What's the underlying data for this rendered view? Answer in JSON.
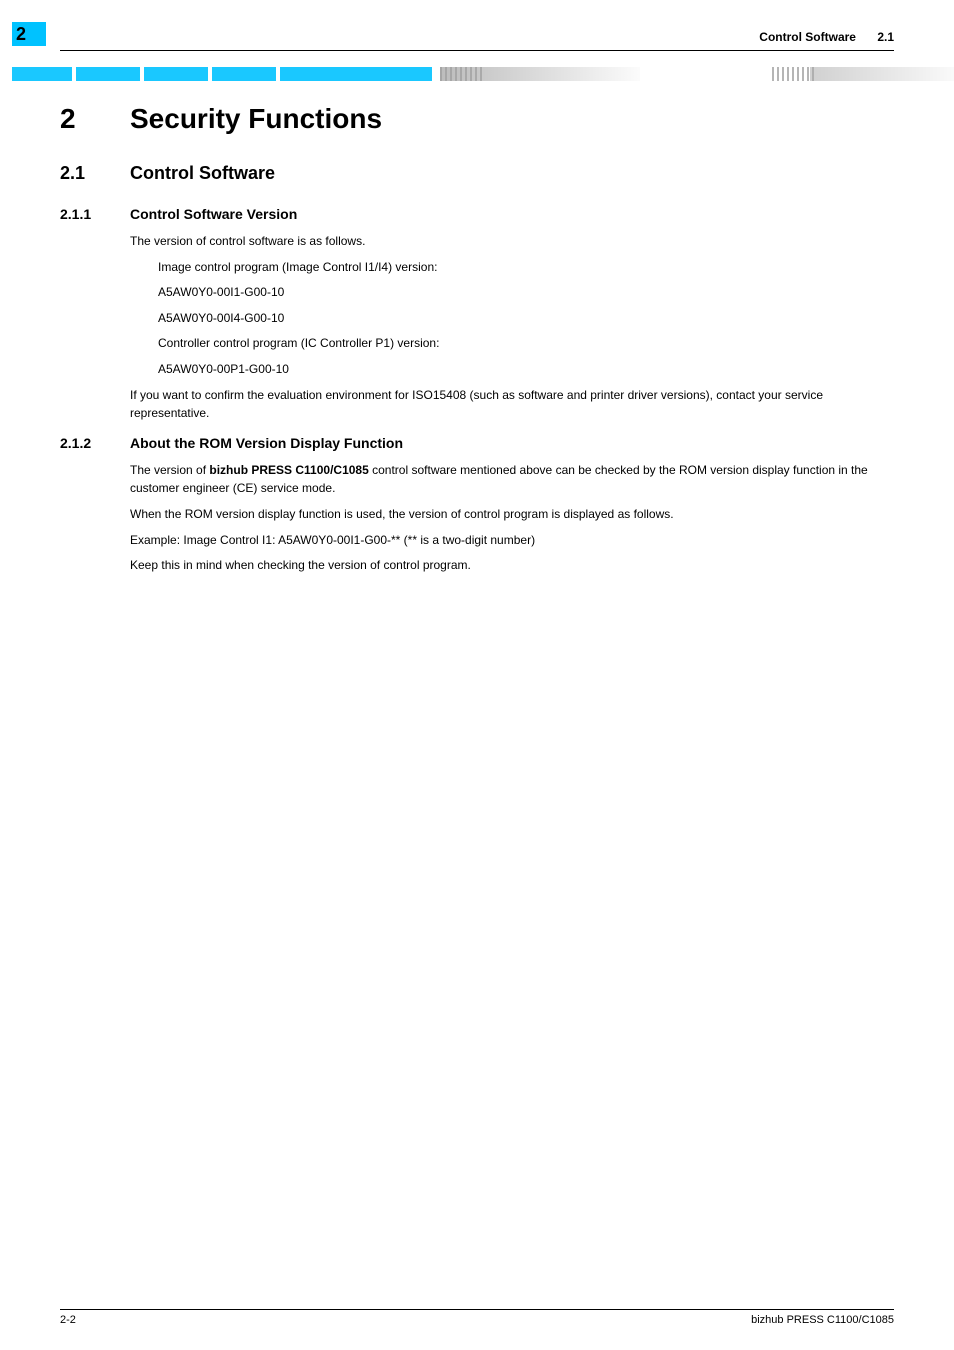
{
  "header": {
    "chapter_tab": "2",
    "section_title": "Control Software",
    "section_number": "2.1"
  },
  "chapter": {
    "number": "2",
    "title": "Security Functions"
  },
  "section": {
    "number": "2.1",
    "title": "Control Software"
  },
  "sub1": {
    "number": "2.1.1",
    "title": "Control Software Version",
    "p1": "The version of control software is as follows.",
    "p2": "Image control program (Image Control I1/I4) version:",
    "p3": "A5AW0Y0-00I1-G00-10",
    "p4": "A5AW0Y0-00I4-G00-10",
    "p5": "Controller control program (IC Controller P1) version:",
    "p6": "A5AW0Y0-00P1-G00-10",
    "p7": "If you want to confirm the evaluation environment for ISO15408 (such as software and printer driver versions), contact your service representative."
  },
  "sub2": {
    "number": "2.1.2",
    "title": "About the ROM Version Display Function",
    "p1a": "The version of ",
    "p1b": "bizhub PRESS C1100/C1085",
    "p1c": " control software mentioned above can be checked by the ROM version display function in the customer engineer (CE) service mode.",
    "p2": "When the ROM version display function is used, the version of control program is displayed as follows.",
    "p3": "Example: Image Control I1: A5AW0Y0-00I1-G00-** (** is a two-digit number)",
    "p4": "Keep this in mind when checking the version of control program."
  },
  "footer": {
    "page": "2-2",
    "product": "bizhub PRESS C1100/C1085"
  }
}
